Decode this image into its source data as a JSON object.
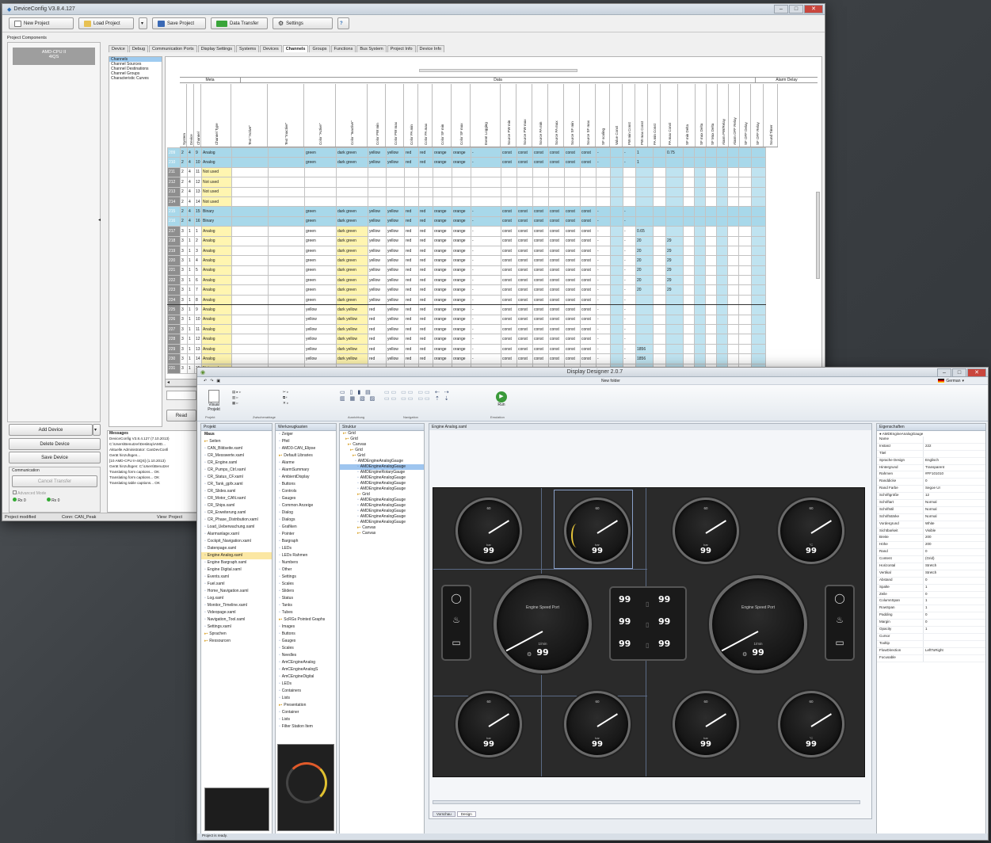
{
  "config_window": {
    "title": "DeviceConfig V3.8.4.127",
    "toolbar": {
      "new_project": "New Project",
      "load_project": "Load Project",
      "save_project": "Save Project",
      "data_transfer": "Data Transfer",
      "settings": "Settings"
    },
    "project_components_label": "Project Components",
    "component": "AMD-CPU II\n4IQS",
    "tabs": [
      "Device",
      "Debug",
      "Communication Ports",
      "Display Settings",
      "Systems",
      "Devices",
      "Channels",
      "Groups",
      "Functions",
      "Bus System",
      "Project Info",
      "Device Info"
    ],
    "active_tab": "Channels",
    "tree": [
      "Channels",
      "Channel Sources",
      "Channel Destinations",
      "Channel Groups",
      "Characteristic Curves"
    ],
    "group_headers": {
      "meta": "Meta",
      "data": "Data",
      "alarm": "Alarm Delay"
    },
    "columns": [
      "System",
      "Device",
      "Channel",
      "Channel Type",
      "Text \"Active\"",
      "Text \"Inactive\"",
      "Color \"Active\"",
      "Color \"Inactive\"",
      "Color PW min",
      "Color PW max",
      "Color PA min",
      "Color PA max",
      "Color SF min",
      "Color SF max",
      "Event Logging",
      "Source PW min",
      "Source PW max",
      "Source PA min",
      "Source PA max",
      "Source SF min",
      "Source SF max",
      "SF scaling",
      "Value Const",
      "PW min Const",
      "PW max Const",
      "PA min Const",
      "PA max Const",
      "SF min Delta",
      "SF max Delta",
      "SF Max Delta",
      "Alarm PW/Relay",
      "Alarm OFF Relay",
      "SF OFF Delay",
      "SF OFF Relay",
      "Sound Timer"
    ],
    "rows": [
      {
        "id": "209",
        "sys": "2",
        "dev": "4",
        "ch": "9",
        "type": "Analog",
        "ca": "green",
        "ci": "dark green",
        "v": "1",
        "m": "0.75",
        "hl": "b"
      },
      {
        "id": "210",
        "sys": "2",
        "dev": "4",
        "ch": "10",
        "type": "Analog",
        "ca": "green",
        "ci": "dark green",
        "v": "1",
        "m": "",
        "hl": "b"
      },
      {
        "id": "211",
        "sys": "2",
        "dev": "4",
        "ch": "11",
        "type": "Not used",
        "ca": "",
        "ci": "",
        "v": "",
        "m": "",
        "hl": "y"
      },
      {
        "id": "212",
        "sys": "2",
        "dev": "4",
        "ch": "12",
        "type": "Not used",
        "ca": "",
        "ci": "",
        "v": "",
        "m": "",
        "hl": "y"
      },
      {
        "id": "213",
        "sys": "2",
        "dev": "4",
        "ch": "13",
        "type": "Not used",
        "ca": "",
        "ci": "",
        "v": "",
        "m": "",
        "hl": "y"
      },
      {
        "id": "214",
        "sys": "2",
        "dev": "4",
        "ch": "14",
        "type": "Not used",
        "ca": "",
        "ci": "",
        "v": "",
        "m": "",
        "hl": "y"
      },
      {
        "id": "215",
        "sys": "2",
        "dev": "4",
        "ch": "15",
        "type": "Binary",
        "ca": "green",
        "ci": "dark green",
        "v": "",
        "m": "",
        "hl": "b"
      },
      {
        "id": "216",
        "sys": "2",
        "dev": "4",
        "ch": "16",
        "type": "Binary",
        "ca": "green",
        "ci": "dark green",
        "v": "",
        "m": "",
        "hl": "b"
      },
      {
        "id": "217",
        "sys": "3",
        "dev": "1",
        "ch": "1",
        "type": "Analog",
        "ca": "green",
        "ci": "dark green",
        "v": "0.65",
        "m": "",
        "hl": "n"
      },
      {
        "id": "218",
        "sys": "3",
        "dev": "1",
        "ch": "2",
        "type": "Analog",
        "ca": "green",
        "ci": "dark green",
        "v": "20",
        "m": "29",
        "hl": "n"
      },
      {
        "id": "219",
        "sys": "3",
        "dev": "1",
        "ch": "3",
        "type": "Analog",
        "ca": "green",
        "ci": "dark green",
        "v": "20",
        "m": "29",
        "hl": "n"
      },
      {
        "id": "220",
        "sys": "3",
        "dev": "1",
        "ch": "4",
        "type": "Analog",
        "ca": "green",
        "ci": "dark green",
        "v": "20",
        "m": "29",
        "hl": "n"
      },
      {
        "id": "221",
        "sys": "3",
        "dev": "1",
        "ch": "5",
        "type": "Analog",
        "ca": "green",
        "ci": "dark green",
        "v": "20",
        "m": "29",
        "hl": "n"
      },
      {
        "id": "222",
        "sys": "3",
        "dev": "1",
        "ch": "6",
        "type": "Analog",
        "ca": "green",
        "ci": "dark green",
        "v": "20",
        "m": "29",
        "hl": "n"
      },
      {
        "id": "223",
        "sys": "3",
        "dev": "1",
        "ch": "7",
        "type": "Analog",
        "ca": "green",
        "ci": "dark green",
        "v": "20",
        "m": "29",
        "hl": "n"
      },
      {
        "id": "224",
        "sys": "3",
        "dev": "1",
        "ch": "8",
        "type": "Analog",
        "ca": "green",
        "ci": "dark green",
        "v": "",
        "m": "",
        "hl": "s"
      },
      {
        "id": "225",
        "sys": "3",
        "dev": "1",
        "ch": "9",
        "type": "Analog",
        "ca": "yellow",
        "ci": "dark yellow",
        "v": "",
        "m": "",
        "hl": "n"
      },
      {
        "id": "226",
        "sys": "3",
        "dev": "1",
        "ch": "10",
        "type": "Analog",
        "ca": "yellow",
        "ci": "dark yellow",
        "v": "",
        "m": "",
        "hl": "n"
      },
      {
        "id": "227",
        "sys": "3",
        "dev": "1",
        "ch": "11",
        "type": "Analog",
        "ca": "yellow",
        "ci": "dark yellow",
        "v": "",
        "m": "",
        "hl": "n"
      },
      {
        "id": "228",
        "sys": "3",
        "dev": "1",
        "ch": "12",
        "type": "Analog",
        "ca": "yellow",
        "ci": "dark yellow",
        "v": "",
        "m": "",
        "hl": "n"
      },
      {
        "id": "229",
        "sys": "3",
        "dev": "1",
        "ch": "13",
        "type": "Analog",
        "ca": "yellow",
        "ci": "dark yellow",
        "v": "1856",
        "m": "",
        "hl": "n"
      },
      {
        "id": "230",
        "sys": "3",
        "dev": "1",
        "ch": "14",
        "type": "Analog",
        "ca": "yellow",
        "ci": "dark yellow",
        "v": "1856",
        "m": "",
        "hl": "n"
      },
      {
        "id": "231",
        "sys": "3",
        "dev": "1",
        "ch": "15",
        "type": "Not used",
        "ca": "",
        "ci": "",
        "v": "",
        "m": "",
        "hl": "y"
      }
    ],
    "row_text": {
      "pw": "yellow",
      "pa": "red",
      "sf": "orange",
      "src": "const",
      "dash": "-"
    },
    "add_device": "Add Device",
    "delete_device": "Delete Device",
    "save_device": "Save Device",
    "communication": "Communication",
    "cancel_transfer": "Cancel Transfer",
    "advanced_mode": "Advanced Mode",
    "rx_label": "Rx 0",
    "tx_label": "Rx 0",
    "read_button": "Read",
    "messages_label": "Messages",
    "messages": [
      "DeviceConfig V3.8.4.127 (7.10.2013)",
      "C:\\Users\\Benutzer\\Desktop\\AMD...",
      "Aktuelle Administrator: CanDevConfi",
      "Gerät hinzufügen...",
      "[10 AMD-CPU II-4IQS] (1.10.2013)",
      "Gerät hinzufügen: C:\\Users\\Benutzer",
      "Translating form captions... OK",
      "Translating form captions... OK",
      "Translating table captions... OK"
    ],
    "status": {
      "left": "Project modified",
      "mid": "Conn: CAN_Peak",
      "right": "View: Project"
    }
  },
  "designer_window": {
    "title": "Display Designer 2.0.7",
    "new_folder": "New folder",
    "language": "German",
    "ribbon": {
      "view_label": "Visual Projekt",
      "run_label": "Run",
      "groups": [
        "Projekt",
        "Zwischenablage",
        "Ausrichtung",
        "Navigation",
        "Emulation"
      ]
    },
    "project_label": "Projekt",
    "project_root": "Maus",
    "project_files": [
      "Seiten",
      "CAN_Bildseite.xaml",
      "CR_Messwerte.xaml",
      "CR_Engine.xaml",
      "CR_Pumps_Ctrl.xaml",
      "CR_Status_CF.xaml",
      "CR_Tank_gpfx.xaml",
      "CR_Slides.xaml",
      "CR_Motor_CAN.xaml",
      "CR_Ships.xaml",
      "CR_Erweiterung.xaml",
      "CR_Phase_Distribution.xaml",
      "Load_Ueberwachung.xaml",
      "Alarmanlage.xaml",
      "Cockpit_Navigation.xaml",
      "Datenpage.xaml",
      "Engine Analog.xaml",
      "Engine Bargraph.xaml",
      "Engine Digital.xaml",
      "Events.xaml",
      "Fuel.xaml",
      "Home_Navigation.xaml",
      "Log.xaml",
      "Monitor_Timeline.xaml",
      "Videopage.xaml",
      "Navigation_Tool.xaml",
      "Settings.xaml",
      "Sprachen",
      "Ressourcen"
    ],
    "widgets_label": "Werkzeugkasten",
    "widget_items": [
      "Zeiger",
      "Pfeil",
      "AMD3-CAN_Elipse",
      "Default Libraries",
      "Alarme",
      "AlarmSummary",
      "AmbientDisplay",
      "Buttons",
      "Controls",
      "Gauges",
      "Common Anzeige",
      "Dialog",
      "Dialogs",
      "Grafiken",
      "Pointer",
      "Bargraph",
      "LEDs",
      "LEDs Rahmen",
      "Numbers",
      "Other",
      "Settings",
      "Scales",
      "Sliders",
      "Status",
      "Tanks",
      "Tubes",
      "ScRGs Pointed Graphs",
      "Images",
      "Buttons",
      "Gauges",
      "Scales",
      "Needles",
      "AmCEngineAnalog",
      "AmCEngineAnalogS",
      "AmCEngineDigital",
      "LEDs",
      "Containers",
      "Lists",
      "Presentation",
      "Container",
      "Lists",
      "Filter Station Item"
    ],
    "visual_label": "Struktur",
    "visual_items": [
      "Grid",
      "Grid",
      "Canvas",
      "Grid",
      "Grid",
      "AMDEngineAnalogGauge",
      "AMDEngineAnalogGauge",
      "AMDEngineRotaryGauge",
      "AMDEngineAnalogGauge",
      "AMDEngineAnalogGauge",
      "AMDEngineAnalogGauge",
      "Grid",
      "AMDEngineAnalogGauge",
      "AMDEngineAnalogGauge",
      "AMDEngineAnalogGauge",
      "AMDEngineAnalogGauge",
      "AMDEngineAnalogGauge",
      "Canvas",
      "Canvas"
    ],
    "canvas_title": "Engine Analog.xaml",
    "gauges": [
      {
        "id": "g1",
        "value": "99",
        "unit": "bar",
        "tick": "60"
      },
      {
        "id": "g2",
        "value": "99",
        "unit": "bar",
        "tick": "60"
      },
      {
        "id": "g3",
        "value": "99",
        "unit": "bar",
        "tick": "60"
      },
      {
        "id": "g4",
        "value": "99",
        "unit": "°C",
        "tick": "60"
      },
      {
        "id": "g5",
        "value": "99",
        "unit": "bar",
        "tick": "60"
      },
      {
        "id": "g6",
        "value": "99",
        "unit": "bar",
        "tick": "60"
      },
      {
        "id": "g7",
        "value": "99",
        "unit": "bar",
        "tick": "60"
      },
      {
        "id": "g8",
        "value": "99",
        "unit": "°C",
        "tick": "60"
      }
    ],
    "rpm_gauges": [
      {
        "id": "r1",
        "title": "Engine Speed Port",
        "value": "99",
        "unit": "1/min"
      },
      {
        "id": "r2",
        "title": "Engine Speed Port",
        "value": "99",
        "unit": "1/min"
      }
    ],
    "lcd_values": [
      "99",
      "99",
      "99",
      "99",
      "99",
      "99"
    ],
    "props_label": "Eigenschaften",
    "props_type": "AMDEngineAnalogGauge",
    "props": [
      [
        "Name",
        ""
      ],
      [
        "Instanz",
        "222"
      ],
      [
        "Titel",
        ""
      ],
      [
        "Sprache Design",
        "Englisch"
      ],
      [
        "Hintergrund",
        "Transparent"
      ],
      [
        "Rahmen",
        "#FF101010"
      ],
      [
        "Randdicke",
        "0"
      ],
      [
        "Rand Farbe",
        "Segoe UI"
      ],
      [
        "Schriftgröße",
        "12"
      ],
      [
        "Schriftart",
        "Normal"
      ],
      [
        "Schriftstil",
        "Normal"
      ],
      [
        "Schriftstärke",
        "Normal"
      ],
      [
        "Vordergrund",
        "White"
      ],
      [
        "Sichtbarkeit",
        "Visible"
      ],
      [
        "Breite",
        "200"
      ],
      [
        "Höhe",
        "200"
      ],
      [
        "Rand",
        "0"
      ],
      [
        "Content",
        "(Grid)"
      ],
      [
        "Horizontal",
        "Stretch"
      ],
      [
        "Vertikal",
        "Stretch"
      ],
      [
        "Abstand",
        "0"
      ],
      [
        "Spalte",
        "1"
      ],
      [
        "Zeile",
        "0"
      ],
      [
        "ColumnSpan",
        "1"
      ],
      [
        "RowSpan",
        "1"
      ],
      [
        "Padding",
        "0"
      ],
      [
        "Margin",
        "0"
      ],
      [
        "Opacity",
        "1"
      ],
      [
        "Cursor",
        ""
      ],
      [
        "Tooltip",
        ""
      ],
      [
        "FlowDirection",
        "LeftToRight"
      ],
      [
        "Focusable",
        ""
      ]
    ],
    "bottom_tabs": [
      "Vorschau",
      "Design"
    ],
    "status": "Project is ready."
  }
}
